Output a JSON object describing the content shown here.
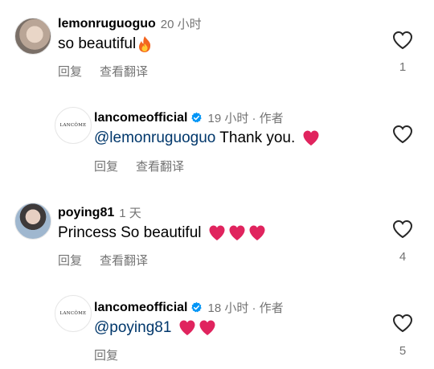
{
  "comments": [
    {
      "username": "lemonruguoguo",
      "time": "20 小时",
      "text": "so beautiful",
      "emoji": [
        "fire"
      ],
      "reply": "回复",
      "translate": "查看翻译",
      "likes": "1"
    },
    {
      "username": "lancomeofficial",
      "time": "19 小时 · 作者",
      "mention": "@lemonruguoguo",
      "text": " Thank you. ",
      "emoji": [
        "red-heart"
      ],
      "reply": "回复",
      "translate": "查看翻译",
      "likes": ""
    },
    {
      "username": "poying81",
      "time": "1 天",
      "text": "Princess So beautiful ",
      "emoji": [
        "red-heart",
        "red-heart",
        "red-heart"
      ],
      "reply": "回复",
      "translate": "查看翻译",
      "likes": "4"
    },
    {
      "username": "lancomeofficial",
      "time": "18 小时 · 作者",
      "mention": "@poying81",
      "text": " ",
      "emoji": [
        "red-heart",
        "red-heart"
      ],
      "reply": "回复",
      "likes": "5"
    }
  ],
  "avatar_logo_text": "LANCÔME",
  "colors": {
    "mention": "#00376b",
    "meta": "#737373",
    "verified": "#0095f6",
    "heart": "#e0245e"
  }
}
